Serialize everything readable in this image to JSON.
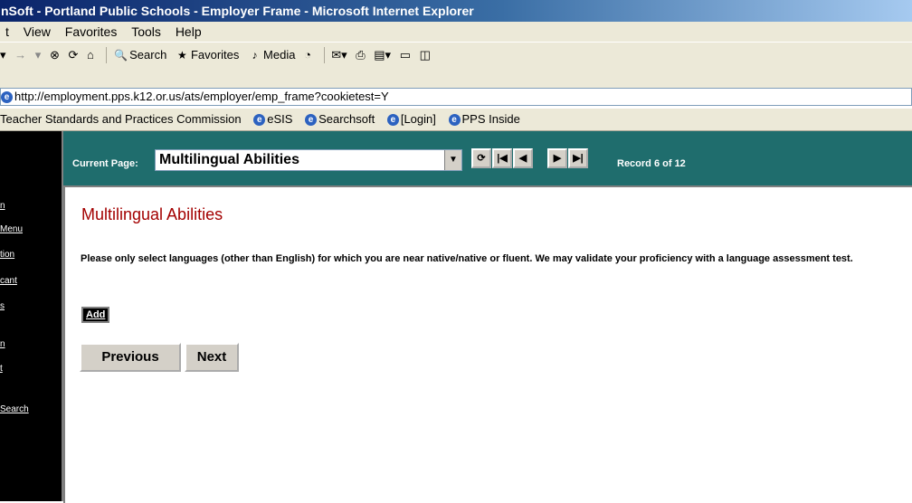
{
  "window": {
    "title": "nSoft - Portland Public Schools - Employer Frame - Microsoft Internet Explorer"
  },
  "menu": {
    "items": [
      "t",
      "View",
      "Favorites",
      "Tools",
      "Help"
    ]
  },
  "toolbar": {
    "search_label": "Search",
    "favorites_label": "Favorites",
    "media_label": "Media"
  },
  "address": {
    "url": "http://employment.pps.k12.or.us/ats/employer/emp_frame?cookietest=Y"
  },
  "links": {
    "items": [
      "Teacher Standards and Practices Commission",
      "eSIS",
      "Searchsoft",
      "[Login]",
      "PPS Inside"
    ]
  },
  "leftnav": {
    "items": [
      "n",
      "Menu",
      "tion",
      "cant",
      "s",
      "n",
      "t",
      "Search"
    ]
  },
  "header": {
    "current_page_label": "Current Page:",
    "current_page_value": "Multilingual Abilities",
    "record_text": "Record 6 of 12"
  },
  "content": {
    "title": "Multilingual Abilities",
    "instructions": "Please only select languages (other than English) for which you are near native/native or fluent. We may validate your proficiency with a language assessment test.",
    "add_label": "Add",
    "previous_label": "Previous",
    "next_label": "Next"
  }
}
